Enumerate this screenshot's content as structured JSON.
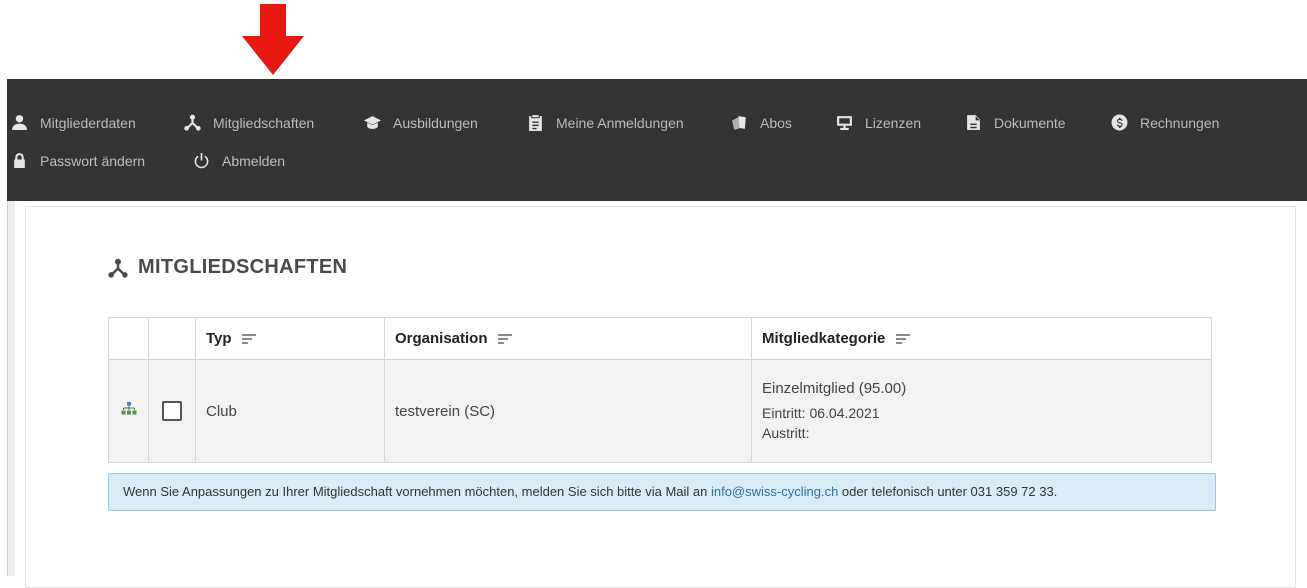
{
  "annotation": {
    "arrow_color": "#e8170f"
  },
  "theme": {
    "nav_bg": "#343434",
    "nav_text": "#bdbdbd",
    "info_bg": "#d9edf7",
    "link": "#2a73a8"
  },
  "nav": {
    "items": [
      {
        "label": "Mitgliederdaten",
        "icon": "person-icon"
      },
      {
        "label": "Mitgliedschaften",
        "icon": "hierarchy-icon"
      },
      {
        "label": "Ausbildungen",
        "icon": "graduation-cap-icon"
      },
      {
        "label": "Meine Anmeldungen",
        "icon": "clipboard-icon"
      },
      {
        "label": "Abos",
        "icon": "tickets-icon"
      },
      {
        "label": "Lizenzen",
        "icon": "monitor-icon"
      },
      {
        "label": "Dokumente",
        "icon": "document-icon"
      },
      {
        "label": "Rechnungen",
        "icon": "dollar-circle-icon"
      },
      {
        "label": "Passwort ändern",
        "icon": "lock-icon"
      },
      {
        "label": "Abmelden",
        "icon": "power-icon"
      }
    ]
  },
  "page": {
    "title": "MITGLIEDSCHAFTEN",
    "title_icon": "hierarchy-icon"
  },
  "table": {
    "headers": [
      "Typ",
      "Organisation",
      "Mitgliedkategorie"
    ],
    "rows": [
      {
        "row_icon": "org-chart-icon",
        "checked": false,
        "typ": "Club",
        "organisation": "testverein (SC)",
        "kategorie": "Einzelmitglied (95.00)",
        "eintritt": "Eintritt: 06.04.2021",
        "austritt": "Austritt:"
      }
    ]
  },
  "info": {
    "text_before": "Wenn Sie Anpassungen zu Ihrer Mitgliedschaft vornehmen möchten, melden Sie sich bitte via Mail an ",
    "email": "info@swiss-cycling.ch",
    "text_after": " oder telefonisch unter 031 359 72 33."
  }
}
